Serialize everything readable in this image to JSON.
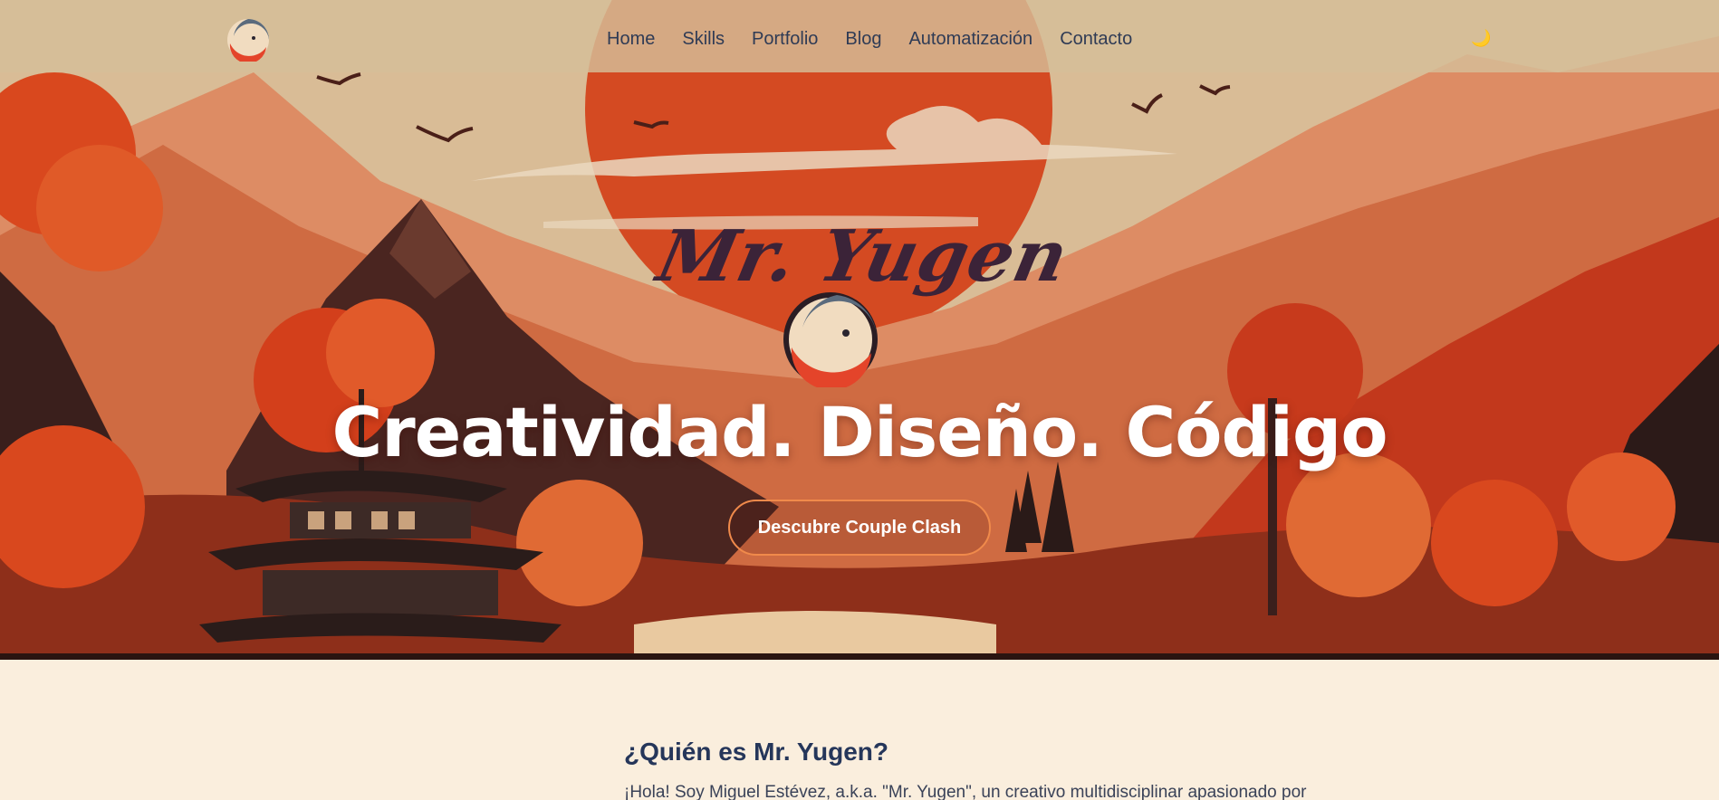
{
  "nav": {
    "logo_icon": "yugen-logo-icon",
    "links": [
      "Home",
      "Skills",
      "Portfolio",
      "Blog",
      "Automatización",
      "Contacto"
    ],
    "theme_toggle": "🌙"
  },
  "hero": {
    "brand": "Mr. Yugen",
    "logo_icon": "yugen-logo-icon",
    "title": "Creatividad. Diseño. Código",
    "cta_label": "Descubre Couple Clash"
  },
  "about": {
    "title": "¿Quién es Mr. Yugen?",
    "text": "¡Hola! Soy Miguel Estévez, a.k.a. \"Mr. Yugen\", un creativo multidisciplinar apasionado por"
  },
  "colors": {
    "accent": "#f08a4b",
    "heading": "#25365a",
    "background": "#faeedd",
    "sun": "#d8491f"
  }
}
